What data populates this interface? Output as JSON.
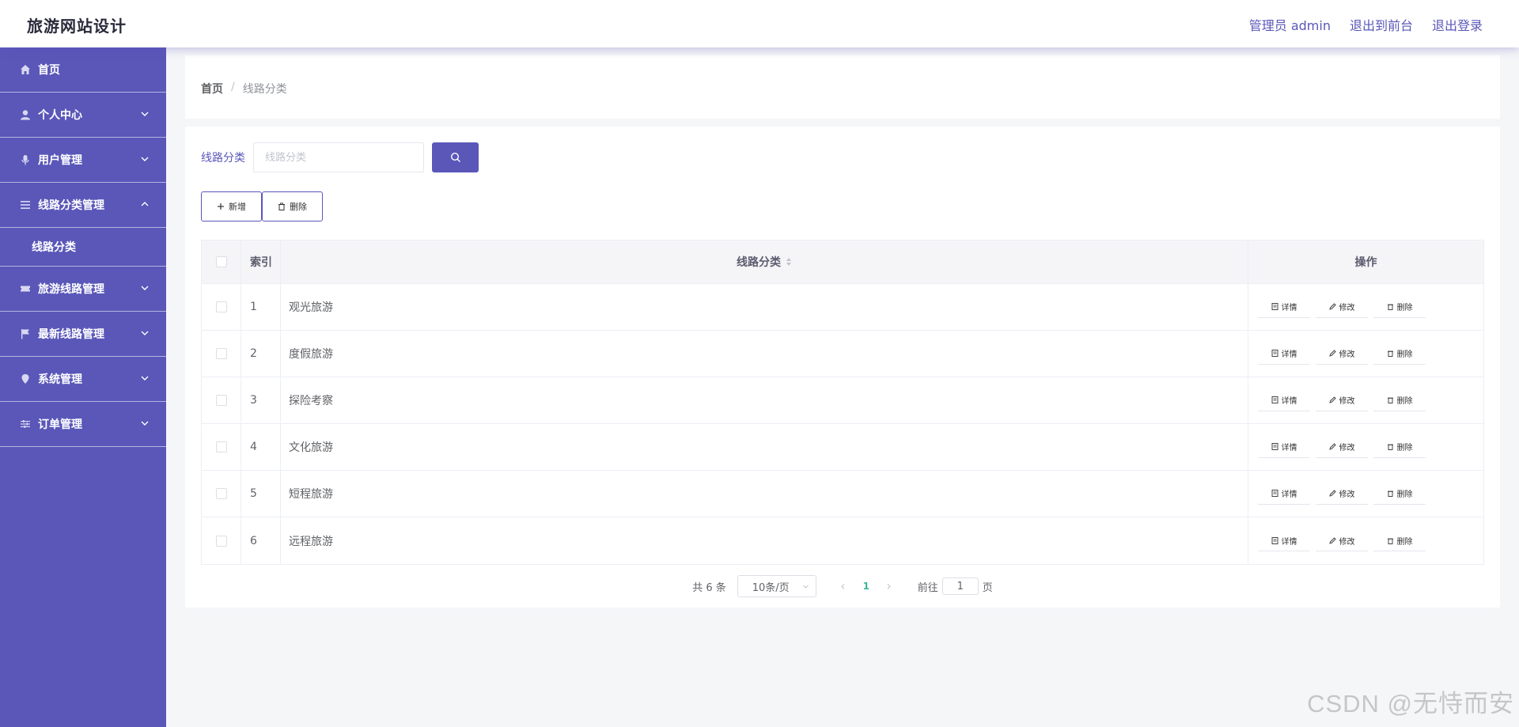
{
  "header": {
    "title": "旅游网站设计",
    "links": [
      "管理员 admin",
      "退出到前台",
      "退出登录"
    ]
  },
  "sidebar": {
    "items": [
      {
        "label": "首页",
        "icon": "home-icon"
      },
      {
        "label": "个人中心",
        "icon": "user-icon"
      },
      {
        "label": "用户管理",
        "icon": "microphone-icon"
      },
      {
        "label": "线路分类管理",
        "icon": "list-icon"
      },
      {
        "label": "旅游线路管理",
        "icon": "ticket-icon"
      },
      {
        "label": "最新线路管理",
        "icon": "flag-icon"
      },
      {
        "label": "系统管理",
        "icon": "location-icon"
      },
      {
        "label": "订单管理",
        "icon": "sliders-icon"
      }
    ],
    "sub_item": "线路分类"
  },
  "breadcrumb": {
    "home": "首页",
    "separator": "/",
    "current": "线路分类"
  },
  "search": {
    "label": "线路分类",
    "placeholder": "线路分类",
    "value": ""
  },
  "actions": {
    "add": "新增",
    "delete": "删除"
  },
  "table": {
    "headers": {
      "index": "索引",
      "name": "线路分类",
      "operation": "操作"
    },
    "rows": [
      {
        "index": "1",
        "name": "观光旅游"
      },
      {
        "index": "2",
        "name": "度假旅游"
      },
      {
        "index": "3",
        "name": "探险考察"
      },
      {
        "index": "4",
        "name": "文化旅游"
      },
      {
        "index": "5",
        "name": "短程旅游"
      },
      {
        "index": "6",
        "name": "远程旅游"
      }
    ],
    "row_actions": {
      "detail": "详情",
      "edit": "修改",
      "delete": "删除"
    }
  },
  "pagination": {
    "total": "共 6 条",
    "page_size": "10条/页",
    "current_page": "1",
    "goto_label": "前往",
    "goto_value": "1",
    "page_unit": "页"
  },
  "watermark": "CSDN @无恃而安",
  "colors": {
    "primary": "#5a57b9",
    "page_active": "#3ab59a",
    "background": "#f5f6f8"
  }
}
